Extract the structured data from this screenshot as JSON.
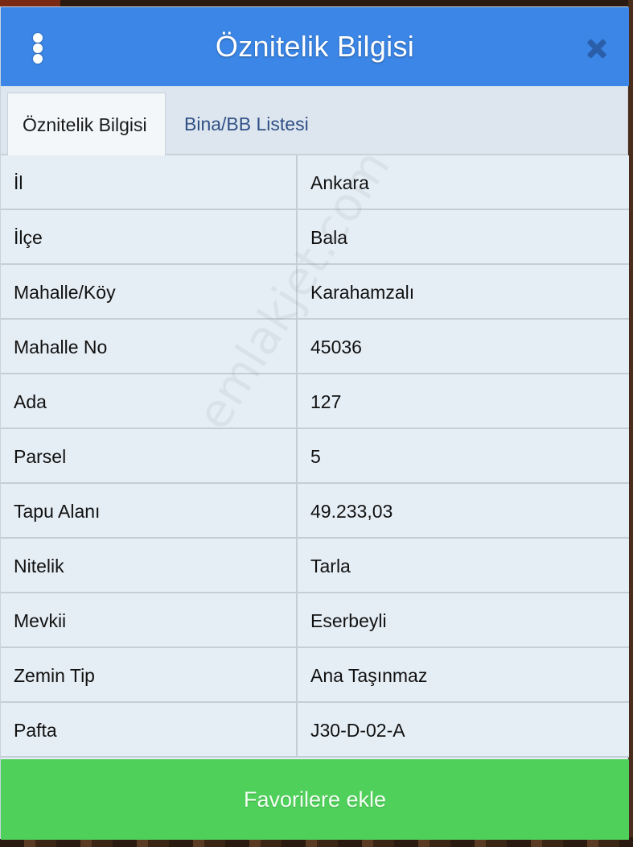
{
  "dialog": {
    "title": "Öznitelik Bilgisi",
    "menu_icon": "more-vertical-icon",
    "close_icon": "close-icon"
  },
  "tabs": [
    {
      "label": "Öznitelik Bilgisi",
      "active": true
    },
    {
      "label": "Bina/BB Listesi",
      "active": false
    }
  ],
  "attributes": [
    {
      "key": "İl",
      "value": "Ankara"
    },
    {
      "key": "İlçe",
      "value": "Bala"
    },
    {
      "key": "Mahalle/Köy",
      "value": "Karahamzalı"
    },
    {
      "key": "Mahalle No",
      "value": "45036"
    },
    {
      "key": "Ada",
      "value": "127"
    },
    {
      "key": "Parsel",
      "value": "5"
    },
    {
      "key": "Tapu Alanı",
      "value": "49.233,03"
    },
    {
      "key": "Nitelik",
      "value": "Tarla"
    },
    {
      "key": "Mevkii",
      "value": "Eserbeyli"
    },
    {
      "key": "Zemin Tip",
      "value": "Ana Taşınmaz"
    },
    {
      "key": "Pafta",
      "value": "J30-D-02-A"
    }
  ],
  "watermark": "emlakjet.com",
  "footer": {
    "favorite_label": "Favorilere ekle"
  },
  "colors": {
    "header": "#3b86e6",
    "footer_button": "#4fd05a",
    "table_bg": "#e6eef5"
  }
}
